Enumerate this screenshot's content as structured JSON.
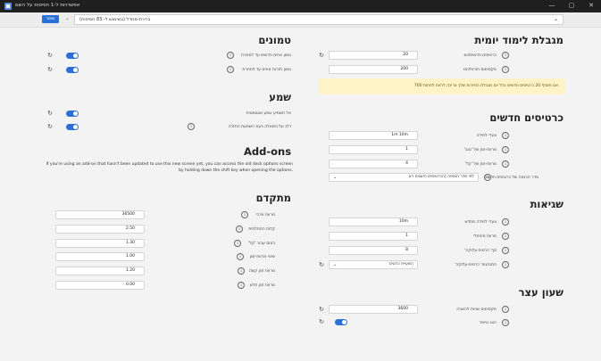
{
  "window": {
    "title": "אפשרויות ל-1 חפיסות על השם",
    "minimize": "—",
    "maximize": "▢",
    "close": "✕"
  },
  "deckbar": {
    "save_label": "שמור",
    "preset_value": "ברירת-מחדל (בשימוש ל- 83 חפיסות)"
  },
  "daily_limits": {
    "title": "מגבלת לימוד יומית",
    "new_cards_label": "כרטיסים חדשים/יום",
    "new_cards_value": "20",
    "max_reviews_label": "מקסימום חזרות/יום",
    "max_reviews_value": "200",
    "warning": "אם תוסיף 20 כרטיסים חדשים בכל יום מגבלת החזרות שלך צריכה להיות לפחות 700"
  },
  "new_cards": {
    "title": "כרטיסים חדשים",
    "learning_steps_label": "צעדי למידה",
    "learning_steps_value": "1m 10m",
    "graduating_interval_label": "מרווח-זמן של 'טוב'",
    "graduating_interval_value": "1",
    "easy_interval_label": "מרווח-זמן של 'קל'",
    "easy_interval_value": "4",
    "insertion_order_label": "סדר הכנסה של כרטיסים חדשים",
    "insertion_order_value": "לפי סדר הוספה (הכרטיסים הישנים רא"
  },
  "lapses": {
    "title": "שגיאות",
    "relearning_steps_label": "צעדי למידה מחדש",
    "relearning_steps_value": "10m",
    "min_interval_label": "מרווח מינימלי",
    "min_interval_value": "1",
    "leech_threshold_label": "סף 'כרטיס-עלוקה'",
    "leech_threshold_value": "8",
    "leech_action_label": "התנהגות 'כרטיס-עלוקה'",
    "leech_action_value": "השעיית כרטיס"
  },
  "burying": {
    "title": "שעון עצר",
    "max_answer_label": "מקסימום שניות להשבה",
    "max_answer_value": "3600",
    "show_timer_label": "הצג טיימר"
  },
  "burying_section": {
    "title": "טמונים",
    "bury_new_label": "טמון אחים חדשים עד למחרת",
    "bury_review_label": "טמון חזרות אחים עד למחרת"
  },
  "audio": {
    "title": "שמע",
    "no_autoplay_label": "אל תשמיע שמע אוטומטית",
    "skip_question_label": "דלג על השאלה בעת השמעת החזרה"
  },
  "addons": {
    "title": "Add-ons",
    "text": "If you're using an add-on that hasn't been updated to use this new screen yet, you can access the old deck options screen by holding down the shift key when opening the options."
  },
  "advanced": {
    "title": "מתקדם",
    "max_interval_label": "מרווח מרבי",
    "max_interval_value": "36500",
    "starting_ease_label": "קלות התחלתית",
    "starting_ease_value": "2.50",
    "easy_bonus_label": "בונוס עבור 'קל'",
    "easy_bonus_value": "1.30",
    "interval_modifier_label": "שינוי מרווח-זמן",
    "interval_modifier_value": "1.00",
    "hard_interval_label": "מרווח זמן קשה",
    "hard_interval_value": "1.20",
    "new_interval_label": "מרווח זמן חדש",
    "new_interval_value": "0.00"
  },
  "icons": {
    "info": "i",
    "reset": "↻",
    "chevron": "⌄"
  },
  "colors": {
    "accent": "#2a6fd6",
    "warning_bg": "#fdf3c7",
    "titlebar": "#1f1f1f"
  }
}
